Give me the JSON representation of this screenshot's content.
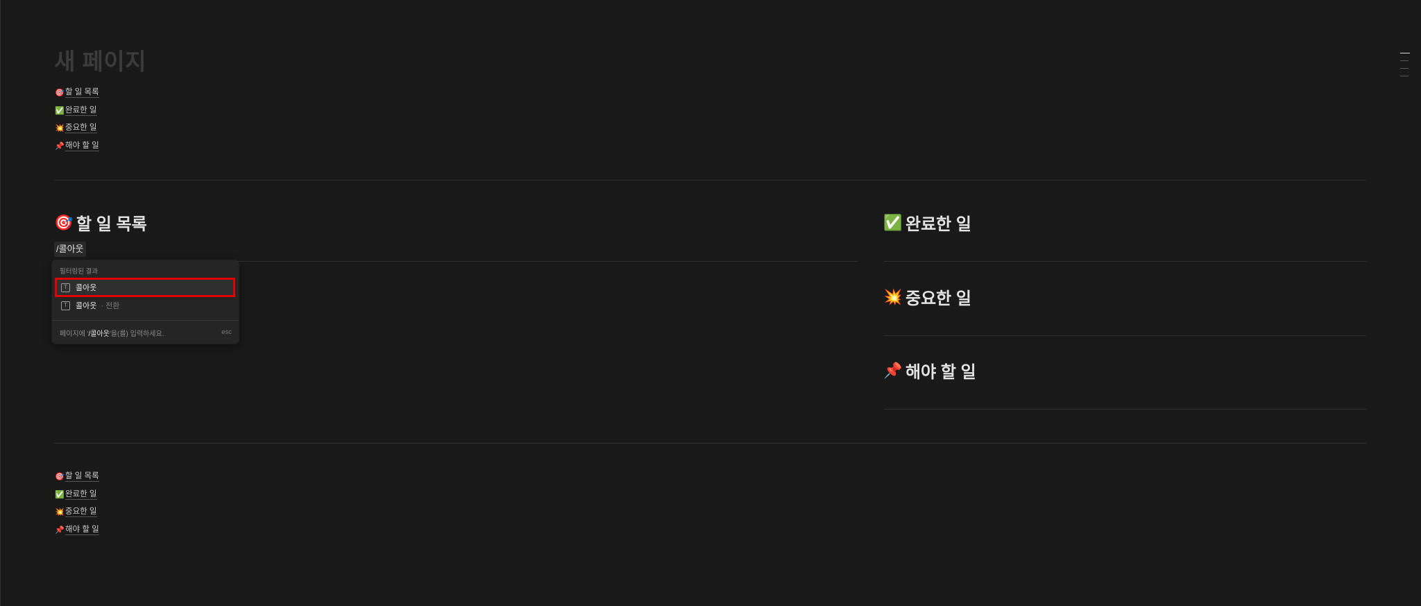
{
  "page": {
    "title": "새 페이지"
  },
  "toc_top": [
    {
      "emoji": "🎯",
      "label": "할 일 목록"
    },
    {
      "emoji": "✅",
      "label": "완료한 일"
    },
    {
      "emoji": "💥",
      "label": "중요한 일"
    },
    {
      "emoji": "📌",
      "label": "해야 할 일"
    }
  ],
  "columns": {
    "left": {
      "emoji": "🎯",
      "heading": "할 일 목록",
      "input_text": "/콜아웃"
    },
    "right": [
      {
        "emoji": "✅",
        "heading": "완료한 일"
      },
      {
        "emoji": "💥",
        "heading": "중요한 일"
      },
      {
        "emoji": "📌",
        "heading": "해야 할 일"
      }
    ]
  },
  "slash_menu": {
    "header": "필터링된 결과",
    "items": [
      {
        "icon": "T",
        "label": "콜아웃",
        "sub": ""
      },
      {
        "icon": "T",
        "label": "콜아웃",
        "sub": "· 전환"
      }
    ],
    "footer_prefix": "페이지에 '",
    "footer_query": "/콜아웃",
    "footer_suffix": "'을(를) 입력하세요.",
    "esc": "esc"
  },
  "toc_bottom": [
    {
      "emoji": "🎯",
      "label": "할 일 목록"
    },
    {
      "emoji": "✅",
      "label": "완료한 일"
    },
    {
      "emoji": "💥",
      "label": "중요한 일"
    },
    {
      "emoji": "📌",
      "label": "해야 할 일"
    }
  ],
  "colors": {
    "background": "#191919",
    "selection_outline": "#e00000"
  }
}
